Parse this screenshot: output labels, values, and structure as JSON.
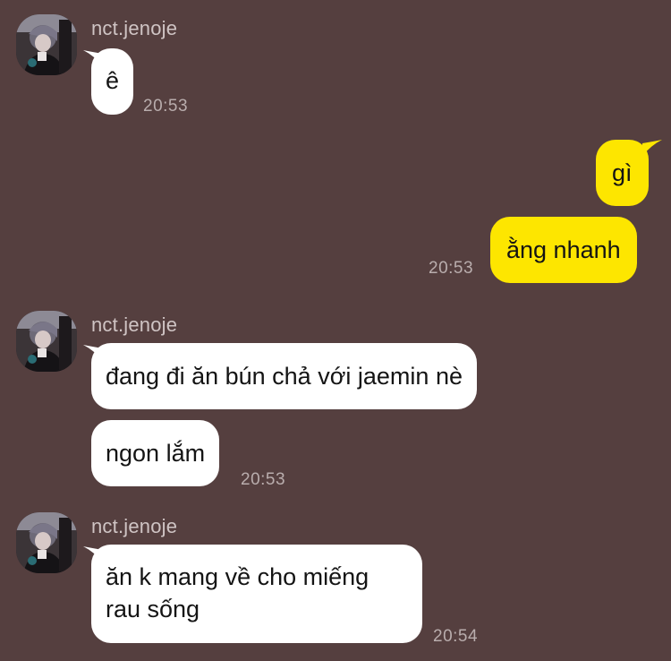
{
  "theme": {
    "background": "#553f3f",
    "incoming_bubble": "#ffffff",
    "outgoing_bubble": "#fde600",
    "text": "#141414",
    "sender_name": "#cfc4c4",
    "timestamp": "#b9adad"
  },
  "groups": [
    {
      "sender": "nct.jenoje",
      "avatar_icon": "profile-photo-icon",
      "messages": [
        "ê"
      ],
      "time": "20:53"
    },
    {
      "sender": "me",
      "messages": [
        "gì",
        "ằng nhanh"
      ],
      "time": "20:53"
    },
    {
      "sender": "nct.jenoje",
      "avatar_icon": "profile-photo-icon",
      "messages": [
        "đang đi ăn bún chả với jaemin nè",
        "ngon lắm"
      ],
      "time": "20:53"
    },
    {
      "sender": "nct.jenoje",
      "avatar_icon": "profile-photo-icon",
      "messages": [
        "ăn k mang về cho miếng\nrau sống"
      ],
      "time": "20:54"
    }
  ]
}
